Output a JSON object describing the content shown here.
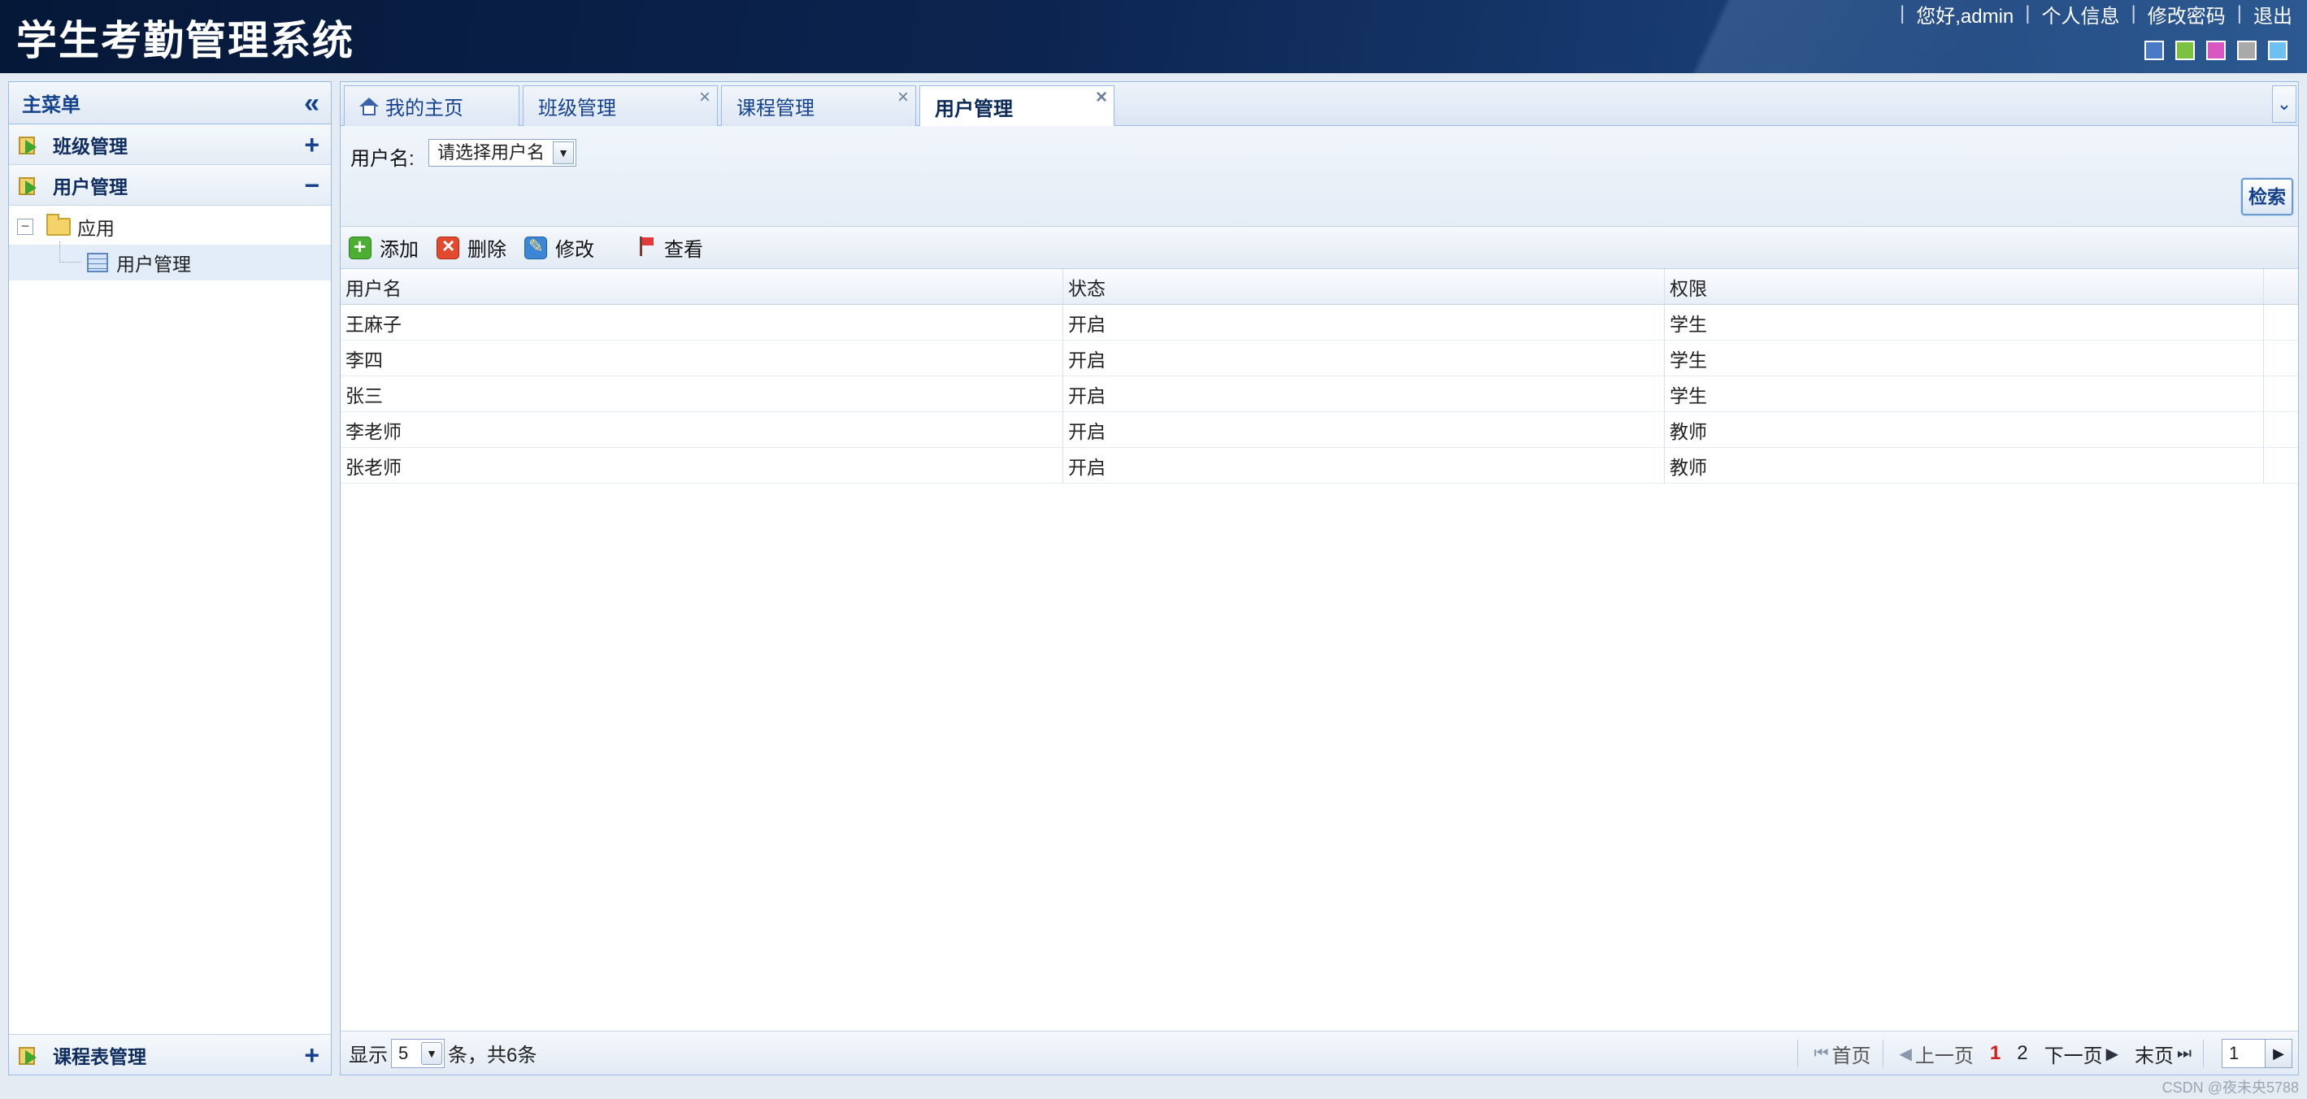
{
  "app": {
    "title": "学生考勤管理系统"
  },
  "top_links": {
    "greeting": "您好,admin",
    "profile": "个人信息",
    "change_password": "修改密码",
    "logout": "退出",
    "separator": "|"
  },
  "themes": [
    "#4a79c5",
    "#7cc142",
    "#d957c3",
    "#a9a9a9",
    "#6ec1ee"
  ],
  "sidebar": {
    "title": "主菜单",
    "collapse_glyph": "«",
    "sections": [
      {
        "label": "班级管理",
        "toggle": "+"
      },
      {
        "label": "用户管理",
        "toggle": "−"
      },
      {
        "label": "课程表管理",
        "toggle": "+"
      }
    ],
    "tree": {
      "toggle": "⊟",
      "folder": "应用",
      "item": "用户管理"
    }
  },
  "tabs": [
    {
      "label": "我的主页",
      "closable": false
    },
    {
      "label": "班级管理",
      "closable": true
    },
    {
      "label": "课程管理",
      "closable": true
    },
    {
      "label": "用户管理",
      "closable": true,
      "active": true
    }
  ],
  "tab_close_glyph": "×",
  "tab_scroll_glyph": "⌄",
  "search": {
    "label": "用户名:",
    "select_value": "请选择用户名",
    "button": "检索"
  },
  "toolbar": {
    "add": "添加",
    "delete": "删除",
    "edit": "修改",
    "view": "查看"
  },
  "grid": {
    "columns": [
      "用户名",
      "状态",
      "权限"
    ],
    "rows": [
      [
        "王麻子",
        "开启",
        "学生"
      ],
      [
        "李四",
        "开启",
        "学生"
      ],
      [
        "张三",
        "开启",
        "学生"
      ],
      [
        "李老师",
        "开启",
        "教师"
      ],
      [
        "张老师",
        "开启",
        "教师"
      ]
    ]
  },
  "pager": {
    "show_label": "显示",
    "page_size": "5",
    "summary": "条，共6条",
    "first": "首页",
    "prev": "上一页",
    "pages": [
      "1",
      "2"
    ],
    "current_page": "1",
    "next": "下一页",
    "last": "末页",
    "page_input": "1"
  },
  "watermark": "CSDN @夜未央5788"
}
